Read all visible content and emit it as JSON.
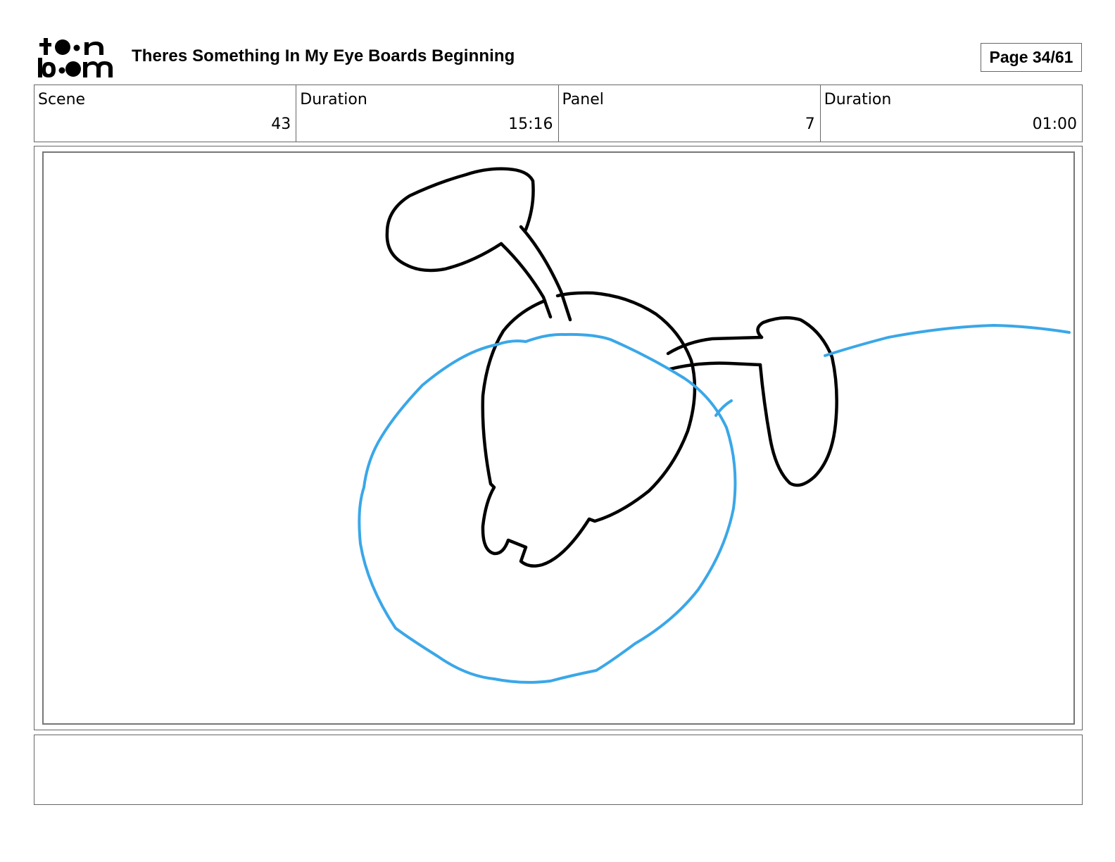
{
  "header": {
    "logo_top": "toon",
    "logo_bottom": "boom",
    "title": "Theres Something In My Eye Boards Beginning",
    "page": "Page 34/61"
  },
  "info": {
    "scene_label": "Scene",
    "scene_value": "43",
    "scene_duration_label": "Duration",
    "scene_duration_value": "15:16",
    "panel_label": "Panel",
    "panel_value": "7",
    "panel_duration_label": "Duration",
    "panel_duration_value": "01:00"
  },
  "drawing": {
    "line_color": "#000000",
    "accent_color": "#3aa7e8"
  },
  "notes": {
    "text": ""
  }
}
